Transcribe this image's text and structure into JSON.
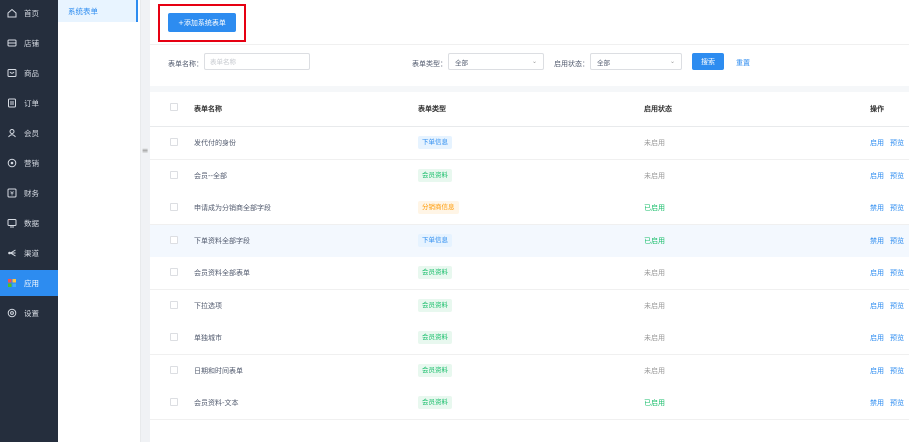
{
  "sidebar": {
    "items": [
      {
        "label": "首页",
        "icon": "home-icon"
      },
      {
        "label": "店铺",
        "icon": "store-icon"
      },
      {
        "label": "商品",
        "icon": "goods-icon"
      },
      {
        "label": "订单",
        "icon": "order-icon"
      },
      {
        "label": "会员",
        "icon": "member-icon"
      },
      {
        "label": "营销",
        "icon": "marketing-icon"
      },
      {
        "label": "财务",
        "icon": "finance-icon"
      },
      {
        "label": "数据",
        "icon": "data-icon"
      },
      {
        "label": "渠道",
        "icon": "channel-icon"
      },
      {
        "label": "应用",
        "icon": "apps-icon",
        "active": true
      },
      {
        "label": "设置",
        "icon": "settings-icon"
      }
    ],
    "active_color": "#2d8cf0"
  },
  "subnav": {
    "active_label": "系统表单"
  },
  "toolbar": {
    "add_label": "+添加系统表单"
  },
  "filter": {
    "name_label": "表单名称：",
    "name_placeholder": "表单名称",
    "type_label": "表单类型：",
    "type_value": "全部",
    "status_label": "启用状态：",
    "status_value": "全部",
    "search_label": "搜索",
    "reset_label": "重置"
  },
  "table": {
    "headers": {
      "name": "表单名称",
      "type": "表单类型",
      "status": "启用状态",
      "ops": "操作"
    },
    "rows": [
      {
        "name": "发代付的身份",
        "type": "下单信息",
        "type_kind": "order",
        "status": "未启用",
        "status_on": false,
        "op1": "启用",
        "op2": "预览"
      },
      {
        "name": "会员--全部",
        "type": "会员资料",
        "type_kind": "member",
        "status": "未启用",
        "status_on": false,
        "op1": "启用",
        "op2": "预览"
      },
      {
        "name": "申请成为分销商全部字段",
        "type": "分销商信息",
        "type_kind": "dist",
        "status": "已启用",
        "status_on": true,
        "op1": "禁用",
        "op2": "预览"
      },
      {
        "name": "下单资料全部字段",
        "type": "下单信息",
        "type_kind": "order",
        "status": "已启用",
        "status_on": true,
        "op1": "禁用",
        "op2": "预览",
        "highlight": true
      },
      {
        "name": "会员资料全部表单",
        "type": "会员资料",
        "type_kind": "member",
        "status": "未启用",
        "status_on": false,
        "op1": "启用",
        "op2": "预览"
      },
      {
        "name": "下拉选项",
        "type": "会员资料",
        "type_kind": "member",
        "status": "未启用",
        "status_on": false,
        "op1": "启用",
        "op2": "预览"
      },
      {
        "name": "单独城市",
        "type": "会员资料",
        "type_kind": "member",
        "status": "未启用",
        "status_on": false,
        "op1": "启用",
        "op2": "预览"
      },
      {
        "name": "日期和时间表单",
        "type": "会员资料",
        "type_kind": "member",
        "status": "未启用",
        "status_on": false,
        "op1": "启用",
        "op2": "预览"
      },
      {
        "name": "会员资料-文本",
        "type": "会员资料",
        "type_kind": "member",
        "status": "已启用",
        "status_on": true,
        "op1": "禁用",
        "op2": "预览"
      }
    ]
  },
  "colors": {
    "primary": "#2d8cf0",
    "success": "#19be6b",
    "warning": "#ff9900",
    "highlight_box": "#e60012"
  }
}
